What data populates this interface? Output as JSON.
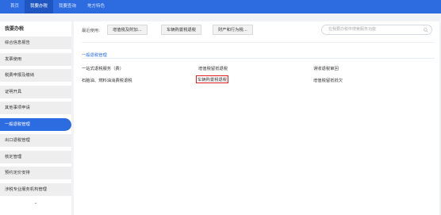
{
  "topnav": {
    "items": [
      "首页",
      "我要办税",
      "我要查询",
      "地方特色"
    ]
  },
  "sidebar": {
    "title": "我要办税",
    "items": [
      "综合信息报告",
      "发票使用",
      "税费申报及缴纳",
      "证明开具",
      "其他事项申请",
      "一般退税管理",
      "出口退税管理",
      "核定管理",
      "预约定价安排",
      "涉税专业服务机构管理"
    ],
    "more_symbol": "⌄"
  },
  "main": {
    "recent_label": "最近使用:",
    "recent_items": [
      "增值税及附加...",
      "车辆购置税退税",
      "财产和行为税..."
    ],
    "search_placeholder": "在我要办税中搜索服务功能",
    "section_title": "一般退税管理",
    "links": {
      "row1": [
        "一站式退税服务（费）",
        "增值税留抵退税",
        "误收退税审回"
      ],
      "row2": [
        "石脑油、燃料油消费税退税",
        "车辆购置税退税",
        "增值税留抵抵欠"
      ]
    }
  },
  "colors": {
    "accent": "#2c6be0",
    "highlight": "#e02020"
  }
}
